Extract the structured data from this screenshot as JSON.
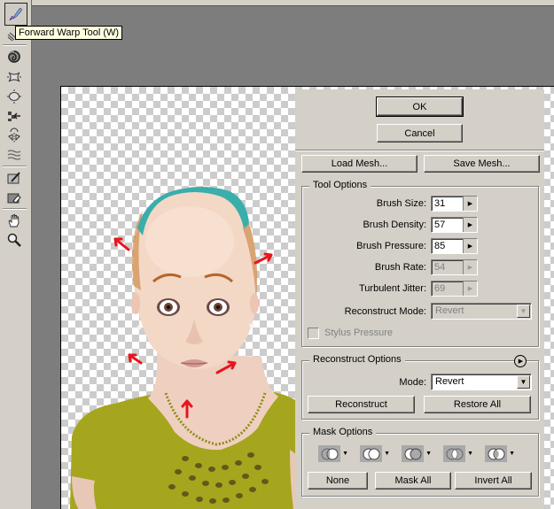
{
  "tooltip": "Forward Warp Tool (W)",
  "toolbar": {
    "tools": [
      {
        "name": "forward-warp-tool",
        "active": true
      },
      {
        "name": "reconstruct-tool"
      },
      {
        "name": "twirl-clockwise-tool"
      },
      {
        "name": "pucker-tool"
      },
      {
        "name": "bloat-tool"
      },
      {
        "name": "push-left-tool"
      },
      {
        "name": "mirror-tool"
      },
      {
        "name": "turbulence-tool"
      },
      {
        "name": "freeze-mask-tool"
      },
      {
        "name": "thaw-mask-tool"
      },
      {
        "name": "hand-tool"
      },
      {
        "name": "zoom-tool"
      }
    ]
  },
  "panel": {
    "ok_label": "OK",
    "cancel_label": "Cancel",
    "load_mesh_label": "Load Mesh...",
    "save_mesh_label": "Save Mesh...",
    "tool_options": {
      "title": "Tool Options",
      "brush_size": {
        "label": "Brush Size:",
        "value": "31"
      },
      "brush_density": {
        "label": "Brush Density:",
        "value": "57"
      },
      "brush_pressure": {
        "label": "Brush Pressure:",
        "value": "85"
      },
      "brush_rate": {
        "label": "Brush Rate:",
        "value": "54",
        "disabled": true
      },
      "turbulent_jitter": {
        "label": "Turbulent Jitter:",
        "value": "69",
        "disabled": true
      },
      "reconstruct_mode": {
        "label": "Reconstruct Mode:",
        "value": "Revert",
        "disabled": true
      },
      "stylus_pressure": {
        "label": "Stylus Pressure",
        "checked": false,
        "disabled": true
      }
    },
    "reconstruct_options": {
      "title": "Reconstruct Options",
      "mode_label": "Mode:",
      "mode_value": "Revert",
      "reconstruct_label": "Reconstruct",
      "restore_all_label": "Restore All"
    },
    "mask_options": {
      "title": "Mask Options",
      "modes": [
        "replace-selection",
        "add-to-selection",
        "subtract-from-selection",
        "intersect-with-selection",
        "invert-selection"
      ],
      "none_label": "None",
      "mask_all_label": "Mask All",
      "invert_all_label": "Invert All"
    }
  },
  "colors": {
    "chrome": "#d4d0c8",
    "workspace": "#7d7d7d",
    "arrow": "#e8141c",
    "headband": "#3aaeab",
    "shirt": "#a8a820"
  }
}
